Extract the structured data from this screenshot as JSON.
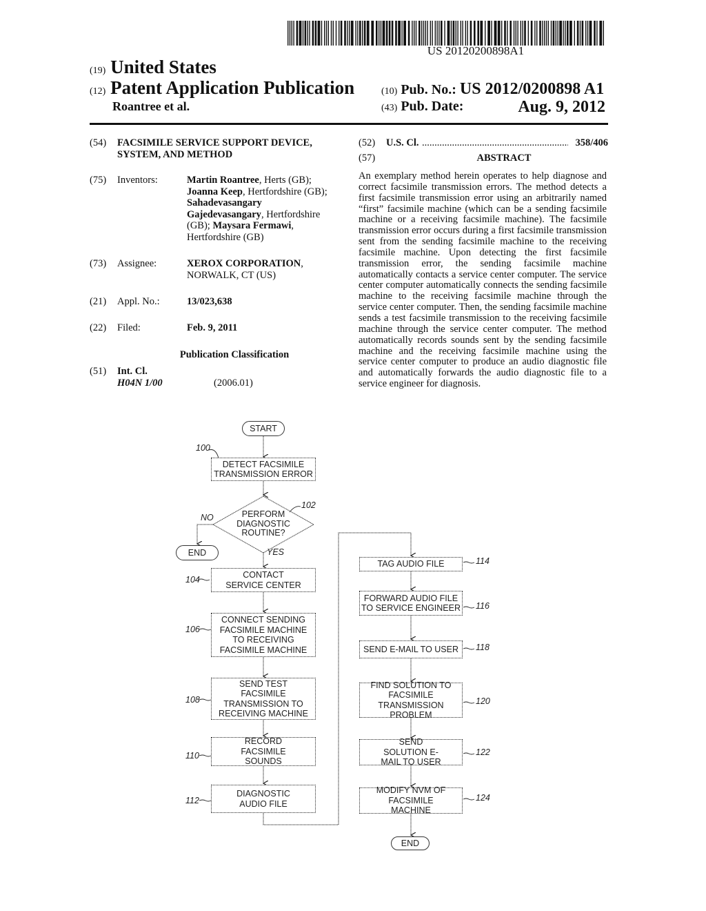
{
  "header": {
    "barcode_number": "US 20120200898A1",
    "country_code": "(19)",
    "country": "United States",
    "doc_type_code": "(12)",
    "doc_type": "Patent Application Publication",
    "applicant": "Roantree et al.",
    "pub_no_code": "(10)",
    "pub_no_label": "Pub. No.:",
    "pub_no": "US 2012/0200898 A1",
    "pub_date_code": "(43)",
    "pub_date_label": "Pub. Date:",
    "pub_date": "Aug. 9, 2012"
  },
  "biblio": {
    "title": {
      "code": "(54)",
      "text": "FACSIMILE SERVICE SUPPORT DEVICE, SYSTEM, AND METHOD"
    },
    "inventors": {
      "code": "(75)",
      "label": "Inventors:",
      "list": [
        {
          "name": "Martin Roantree",
          "loc": ", Herts (GB);"
        },
        {
          "name": "Joanna Keep",
          "loc": ", Hertfordshire (GB);"
        },
        {
          "name": "Sahadevasangary Gajedevasangary",
          "loc": ", Hertfordshire (GB);"
        },
        {
          "name": "Maysara Fermawi",
          "loc": ", Hertfordshire (GB)"
        }
      ]
    },
    "assignee": {
      "code": "(73)",
      "label": "Assignee:",
      "name": "XEROX CORPORATION",
      "loc": "NORWALK, CT (US)"
    },
    "appl_no": {
      "code": "(21)",
      "label": "Appl. No.:",
      "value": "13/023,638"
    },
    "filed": {
      "code": "(22)",
      "label": "Filed:",
      "value": "Feb. 9, 2011"
    },
    "pub_class_heading": "Publication Classification",
    "int_cl": {
      "code": "(51)",
      "label": "Int. Cl.",
      "class": "H04N 1/00",
      "version": "(2006.01)"
    },
    "us_cl": {
      "code": "(52)",
      "label": "U.S. Cl.",
      "dots": "..............................................................................",
      "value": "358/406"
    },
    "abstract": {
      "code": "(57)",
      "heading": "ABSTRACT",
      "text": "An exemplary method herein operates to help diagnose and correct facsimile transmission errors. The method detects a first facsimile transmission error using an arbitrarily named “first” facsimile machine (which can be a sending facsimile machine or a receiving facsimile machine). The facsimile transmission error occurs during a first facsimile transmission sent from the sending facsimile machine to the receiving facsimile machine. Upon detecting the first facsimile transmission error, the sending facsimile machine automatically contacts a service center computer. The service center computer automatically connects the sending facsimile machine to the receiving facsimile machine through the service center computer. Then, the sending facsimile machine sends a test facsimile transmission to the receiving facsimile machine through the service center computer. The method automatically records sounds sent by the sending facsimile machine and the receiving facsimile machine using the service center computer to produce an audio diagnostic file and automatically forwards the audio diagnostic file to a service engineer for diagnosis."
    }
  },
  "flowchart": {
    "start": "START",
    "end_no": "END",
    "end_final": "END",
    "decision": {
      "ref": "102",
      "line1": "PERFORM",
      "line2": "DIAGNOSTIC",
      "line3": "ROUTINE?",
      "no": "NO",
      "yes": "YES"
    },
    "steps_left": [
      {
        "ref": "100",
        "text": "DETECT FACSIMILE TRANSMISSION ERROR"
      },
      {
        "ref": "104",
        "text": "CONTACT SERVICE CENTER"
      },
      {
        "ref": "106",
        "text": "CONNECT SENDING FACSIMILE MACHINE TO RECEIVING FACSIMILE MACHINE"
      },
      {
        "ref": "108",
        "text": "SEND TEST FACSIMILE TRANSMISSION TO RECEIVING MACHINE"
      },
      {
        "ref": "110",
        "text": "RECORD FACSIMILE SOUNDS"
      },
      {
        "ref": "112",
        "text": "DIAGNOSTIC AUDIO FILE"
      }
    ],
    "steps_right": [
      {
        "ref": "114",
        "text": "TAG AUDIO FILE"
      },
      {
        "ref": "116",
        "text": "FORWARD AUDIO FILE TO SERVICE ENGINEER"
      },
      {
        "ref": "118",
        "text": "SEND E-MAIL TO USER"
      },
      {
        "ref": "120",
        "text": "FIND SOLUTION TO FACSIMILE TRANSMISSION PROBLEM"
      },
      {
        "ref": "122",
        "text": "SEND SOLUTION E-MAIL TO USER"
      },
      {
        "ref": "124",
        "text": "MODIFY NVM OF FACSIMILE MACHINE"
      }
    ]
  }
}
